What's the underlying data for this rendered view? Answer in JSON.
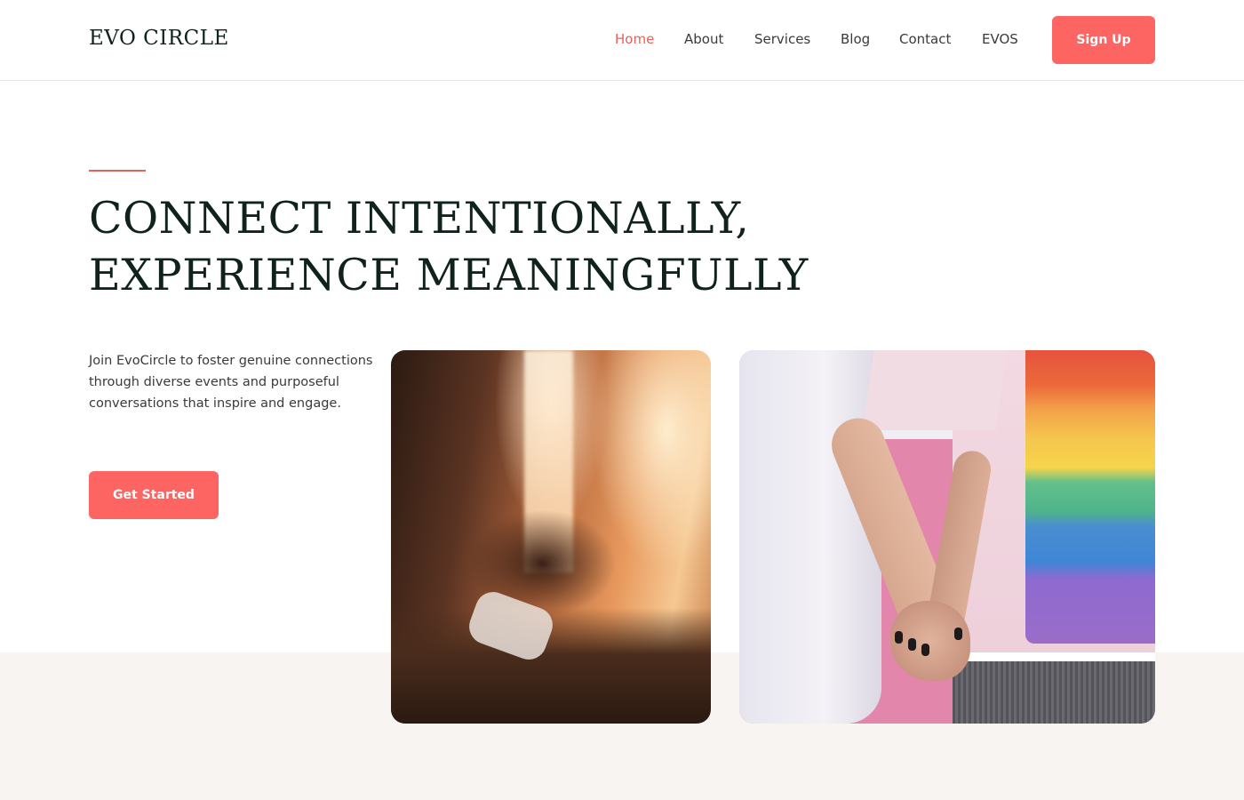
{
  "brand": {
    "logo": "EVO CIRCLE"
  },
  "nav": {
    "items": [
      {
        "label": "Home",
        "active": true
      },
      {
        "label": "About",
        "active": false
      },
      {
        "label": "Services",
        "active": false
      },
      {
        "label": "Blog",
        "active": false
      },
      {
        "label": "Contact",
        "active": false
      },
      {
        "label": "EVOS",
        "active": false
      }
    ],
    "signup_label": "Sign Up"
  },
  "hero": {
    "title_line1": "CONNECT INTENTIONALLY,",
    "title_line2": "EXPERIENCE MEANINGFULLY",
    "description": "Join EvoCircle to foster genuine connections through diverse events and purposeful conversations that inspire and engage.",
    "cta_label": "Get Started"
  },
  "colors": {
    "accent": "#fd6563",
    "active_nav": "#e8605b",
    "heading": "#0f221c",
    "band_background": "#f8f4f2"
  }
}
